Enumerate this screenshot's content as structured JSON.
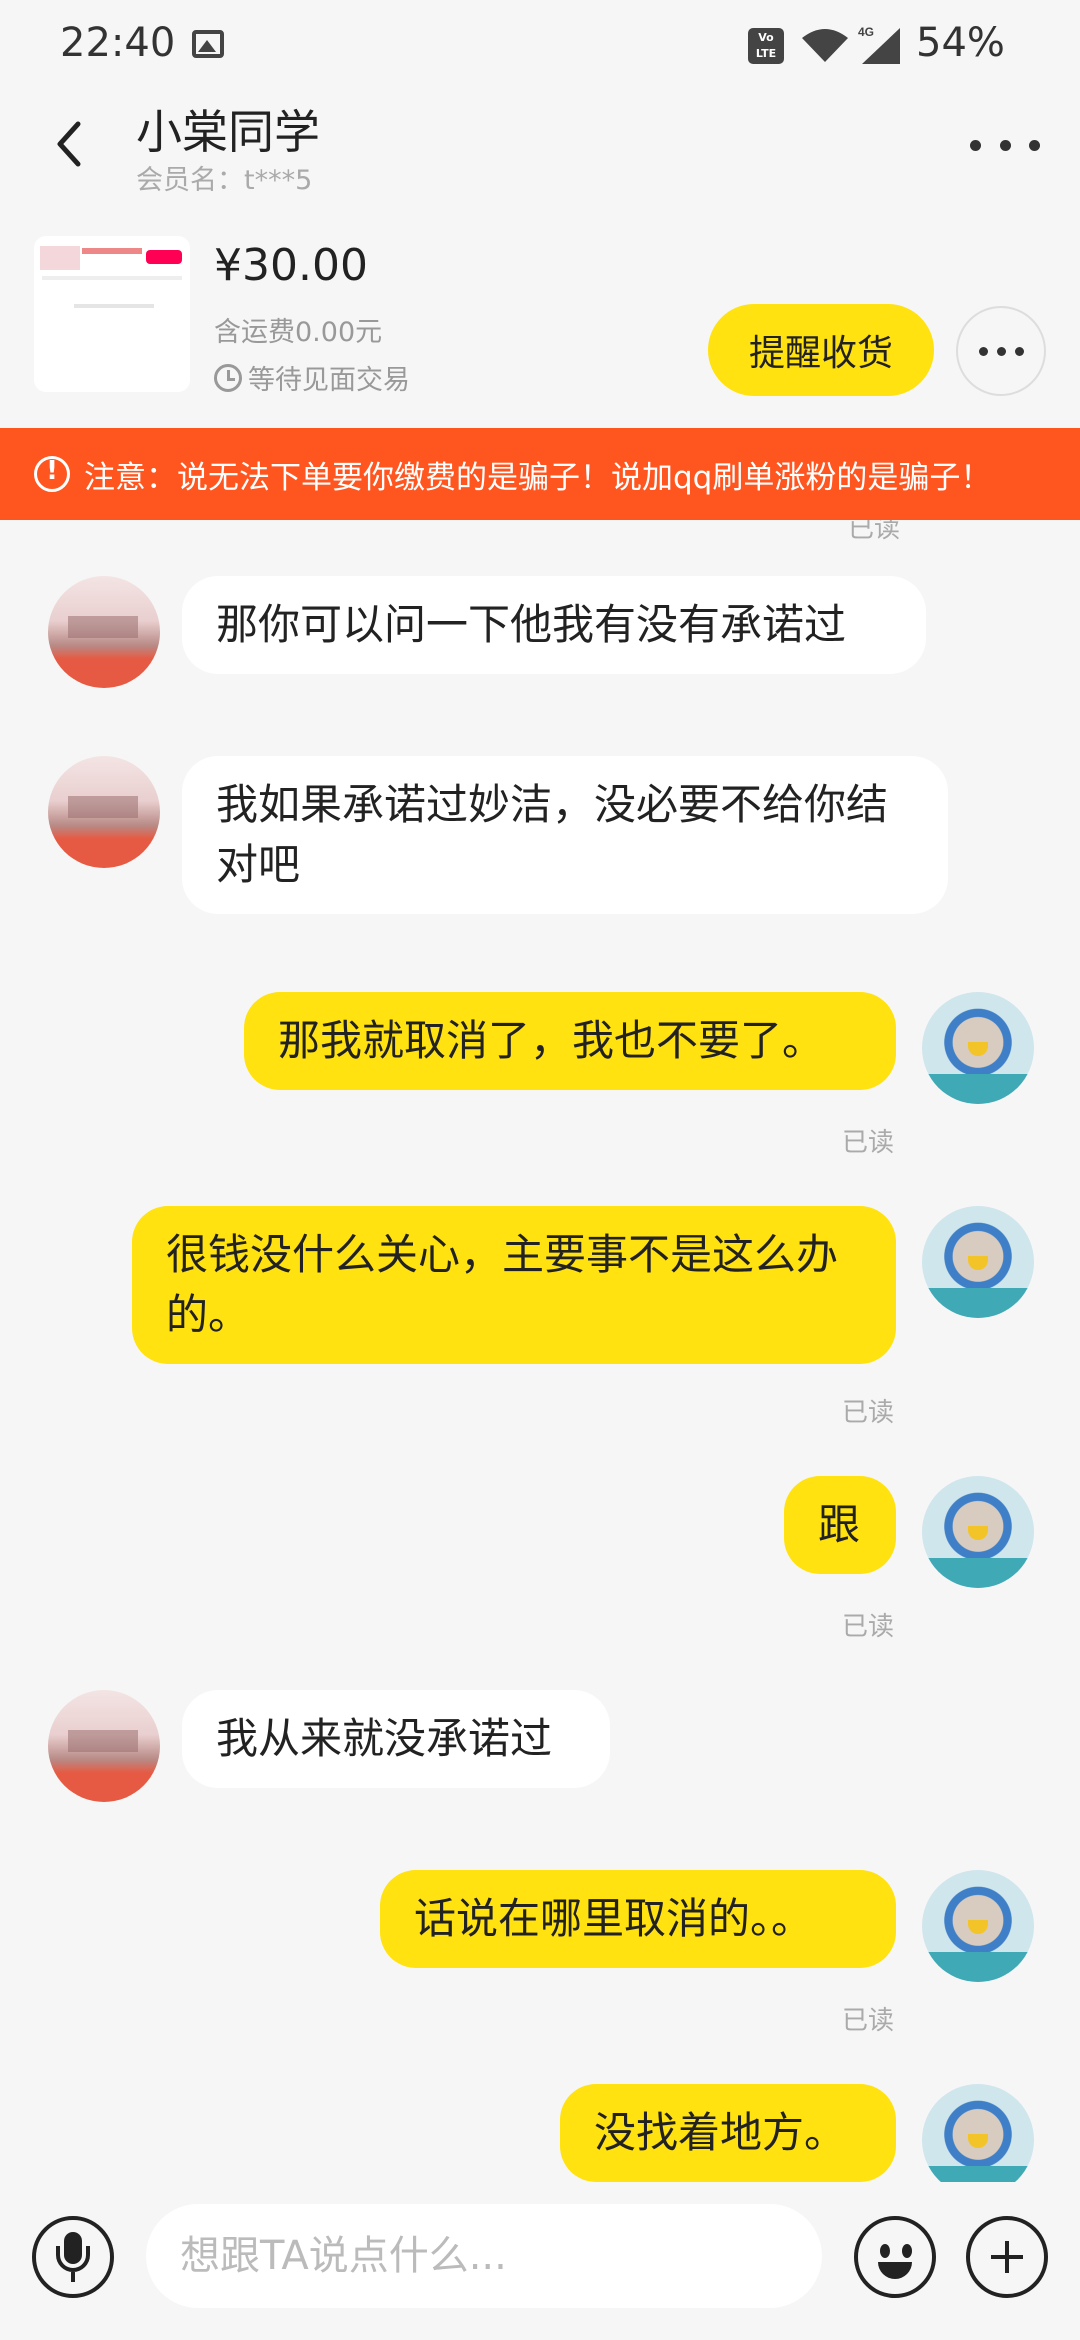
{
  "status_bar": {
    "time": "22:40",
    "volte": "Vo LTE",
    "network": "4G",
    "battery": "54%",
    "icons": [
      "image-icon",
      "volte-icon",
      "wifi-icon",
      "signal-icon"
    ]
  },
  "header": {
    "title": "小棠同学",
    "subtitle": "会员名：t***5",
    "back_icon": "back-arrow-icon",
    "more_icon": "more-dots-icon"
  },
  "product": {
    "price": "¥30.00",
    "shipping": "含运费0.00元",
    "status": "等待见面交易",
    "remind_button": "提醒收货"
  },
  "warning": {
    "text": "注意：说无法下单要你缴费的是骗子！说加qq刷单涨粉的是骗子！",
    "color": "#ff5620"
  },
  "chat": {
    "cut_read_label": "已读",
    "messages": [
      {
        "side": "left",
        "text": "那你可以问一下他我有没有承诺过"
      },
      {
        "side": "left",
        "text": "我如果承诺过妙洁，没必要不给你结对吧"
      },
      {
        "side": "right",
        "text": "那我就取消了，我也不要了。",
        "read": "已读"
      },
      {
        "side": "right",
        "text": "很钱没什么关心，主要事不是这么办的。",
        "read": "已读"
      },
      {
        "side": "right",
        "text": "跟",
        "read": "已读"
      },
      {
        "side": "left",
        "text": "我从来就没承诺过"
      },
      {
        "side": "right",
        "text": "话说在哪里取消的。。",
        "read": "已读"
      },
      {
        "side": "right",
        "text": "没找着地方。"
      }
    ]
  },
  "input_bar": {
    "placeholder": "想跟TA说点什么...",
    "icons": [
      "microphone-icon",
      "emoji-icon",
      "plus-icon"
    ]
  },
  "colors": {
    "accent_yellow": "#ffe20f",
    "background": "#f6f6f6",
    "warning_orange": "#ff5620"
  }
}
